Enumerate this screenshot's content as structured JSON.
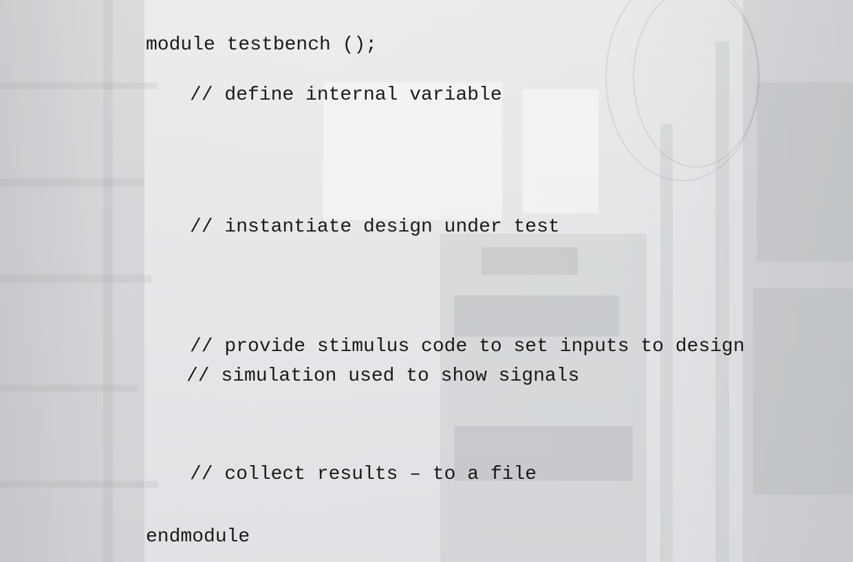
{
  "slide": {
    "lines": {
      "module_decl": "module testbench ();",
      "comment_define": "// define internal variable",
      "comment_instantiate": "// instantiate design under test",
      "comment_stimulus": "// provide stimulus code to set inputs to design",
      "comment_simulation": "// simulation used to show signals",
      "comment_collect": "// collect results – to a file",
      "end_decl": "endmodule"
    }
  }
}
